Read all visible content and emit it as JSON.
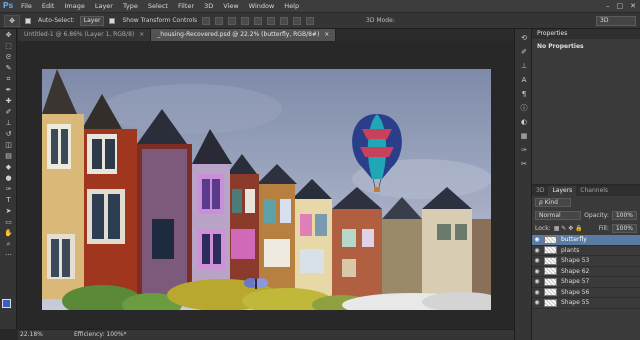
{
  "app": {
    "logo": "Ps"
  },
  "menu": [
    "File",
    "Edit",
    "Image",
    "Layer",
    "Type",
    "Select",
    "Filter",
    "3D",
    "View",
    "Window",
    "Help"
  ],
  "window_controls": [
    "–",
    "□",
    "✕"
  ],
  "options": {
    "auto_select_label": "Auto-Select:",
    "auto_select_value": "Layer",
    "transform_label": "Show Transform Controls",
    "mode_3d_label": "3D Mode:",
    "workspace": "3D"
  },
  "tabs": [
    {
      "label": "Untitled-1 @ 6.86% (Layer 1, RGB/8)",
      "close": "×"
    },
    {
      "label": "_housing-Recovered.psd @ 22.2% (butterfly, RGB/8#)",
      "close": "×"
    }
  ],
  "status": {
    "zoom": "22.18%",
    "efficiency": "Efficiency: 100%*"
  },
  "properties": {
    "tab": "Properties",
    "subtitle": "No Properties"
  },
  "layers_panel": {
    "tabs": [
      "3D",
      "Layers",
      "Channels"
    ],
    "kind": "ρ Kind",
    "blend_mode": "Normal",
    "opacity_label": "Opacity:",
    "opacity": "100%",
    "lock_label": "Lock:",
    "fill_label": "Fill:",
    "fill": "100%",
    "layers": [
      "butterfly",
      "plants",
      "Shape 53",
      "Shape 62",
      "Shape 57",
      "Shape 56",
      "Shape 55"
    ]
  }
}
